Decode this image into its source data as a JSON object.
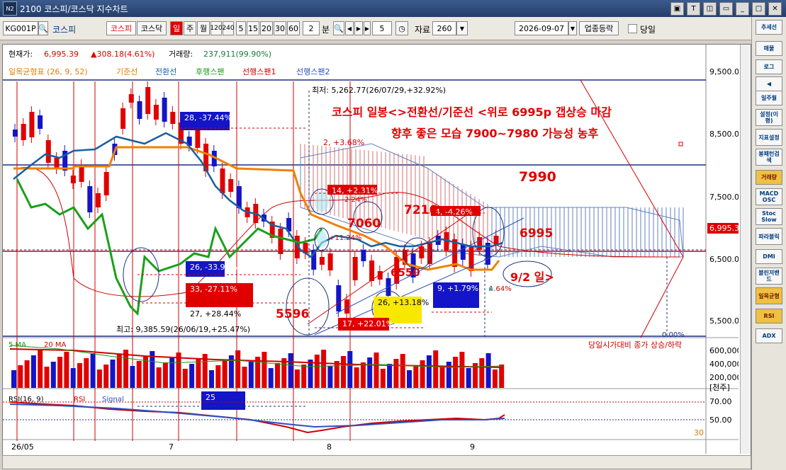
{
  "window": {
    "badge": "N2",
    "title": "2100 코스피/코스닥 지수차트",
    "buttons": [
      "▣",
      "T",
      "◫",
      "▭",
      "_",
      "□",
      "✕"
    ]
  },
  "toolbar": {
    "code": "KG001P",
    "name": "코스피",
    "market_tabs": [
      "코스피",
      "코스닥"
    ],
    "periods": [
      "일",
      "주",
      "월",
      "120",
      "240",
      "5",
      "15",
      "20",
      "30",
      "60"
    ],
    "selected_period": "일",
    "minute_value": "2",
    "minute_label": "분",
    "nav_value": "5",
    "data_label": "자료",
    "data_count": "260",
    "date": "2026-09-07",
    "sector_button": "업종등락",
    "check_label": "당일"
  },
  "side_panel": {
    "items": [
      "추세선",
      "매물",
      "로그",
      "◀",
      "일주월",
      "설정(이평)",
      "지표설정",
      "봉패턴검색",
      "거래량",
      "MACD OSC",
      "Stoc Slow",
      "파라볼릭",
      "DMI",
      "볼린저밴드",
      "일목균형",
      "RSI",
      "ADX"
    ]
  },
  "info": {
    "price_label": "현재가:",
    "price": "6,995.39",
    "change": "▲308.18(4.61%)",
    "volume_label": "거래량:",
    "volume": "237,911(99.90%)"
  },
  "legend": [
    {
      "text": "일목균형표 (26, 9, 52)",
      "color": "#e08000"
    },
    {
      "text": "기준선",
      "color": "#e08000"
    },
    {
      "text": "전환선",
      "color": "#1a5fa0"
    },
    {
      "text": "후행스팬",
      "color": "#1a9a1a"
    },
    {
      "text": "선행스팬1",
      "color": "#d00000"
    },
    {
      "text": "선행스팬2",
      "color": "#2a50c0"
    }
  ],
  "price_axis": [
    "9,500.00",
    "8,500.00",
    "7,500.00",
    "6,500.00",
    "5,500.00"
  ],
  "current_price_tag": "6,995.39",
  "annotations": {
    "high": "최저: 5,262.77(26/07/29,+32.92%)",
    "low": "최고: 9,385.59(26/06/19,+25.47%)",
    "comment_line1": "코스피 일봉<>전환선/기준선 <위로 6995p 갭상승 마감",
    "comment_line2": "향후 좋은 모습 7900~7980 가능성 농후",
    "levels": [
      "7990",
      "7216",
      "7060",
      "6995",
      "6550",
      "5596"
    ],
    "date_note": "9/2 일>",
    "boxes": [
      "28, -37.44%",
      "26, -33.97%",
      "33, -27.11%",
      "27, +28.44%",
      "2, +3.68%",
      "14, +2.31%",
      "4, -4.26%",
      "26, +13.18%",
      "17, +22.01%",
      "9, +1.79%",
      "25"
    ],
    "small_labels": [
      "2.24%",
      "+11.24%",
      "1.64%",
      "0.00%"
    ]
  },
  "volume_panel": {
    "legend": [
      "5 MA",
      "20 MA"
    ],
    "right_label": "당일시가대비 종가 상승/하락",
    "axis": [
      "600,000",
      "400,000",
      "200,000"
    ],
    "unit": "[천주]"
  },
  "rsi_panel": {
    "legend": [
      "RSI(16, 9)",
      "RSI",
      "Signal"
    ],
    "axis": [
      "70.00",
      "50.00"
    ],
    "corner": "30"
  },
  "x_axis": [
    "26/05",
    "7",
    "8",
    "9"
  ],
  "colors": {
    "up": "#e00000",
    "down": "#1414c8",
    "accent": "#e00000"
  }
}
